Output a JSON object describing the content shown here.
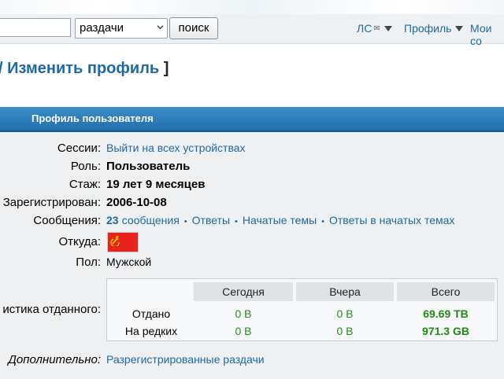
{
  "toolbar": {
    "select_value": "раздачи",
    "search_button": "поиск",
    "nav": [
      {
        "label": "ЛС",
        "icon": "envelope-icon"
      },
      {
        "label": "Профиль"
      },
      {
        "label": "Мои со"
      }
    ]
  },
  "page": {
    "title_prefix": "/",
    "title": "Изменить профиль",
    "title_suffix": "]"
  },
  "panel": {
    "header": "Профиль пользователя"
  },
  "profile": {
    "sessions": {
      "label": "Сессии:",
      "value": "Выйти на всех устройствах"
    },
    "role": {
      "label": "Роль:",
      "value": "Пользователь"
    },
    "tenure": {
      "label": "Стаж:",
      "value": "19 лет 9 месяцев"
    },
    "registered": {
      "label": "Зарегистрирован:",
      "value": "2006-10-08"
    },
    "messages": {
      "label": "Сообщения:",
      "count": "23",
      "count_text": "сообщения",
      "links": [
        "Ответы",
        "Начатые темы",
        "Ответы в начатых темах"
      ],
      "separator": "•"
    },
    "origin": {
      "label": "Откуда:",
      "flag_icon": "ussr-flag-icon"
    },
    "gender": {
      "label": "Пол:",
      "value": "Мужской"
    },
    "stats": {
      "label": "истика отданного:",
      "headers": [
        "Сегодня",
        "Вчера",
        "Всего"
      ],
      "rows": [
        {
          "name": "Отдано",
          "today": "0 B",
          "yesterday": "0 B",
          "total": "69.69 TB"
        },
        {
          "name": "На редких",
          "today": "0 B",
          "yesterday": "0 B",
          "total": "971.3 GB"
        }
      ]
    },
    "extra": {
      "label": "Дополнительно:",
      "value": "Разрегистрированные раздачи"
    }
  },
  "colors": {
    "link": "#1d6aa3",
    "header_blue": "#2a7dbb",
    "green": "#2a8a18",
    "flag_red": "#e8231d",
    "flag_gold": "#f2d200"
  }
}
